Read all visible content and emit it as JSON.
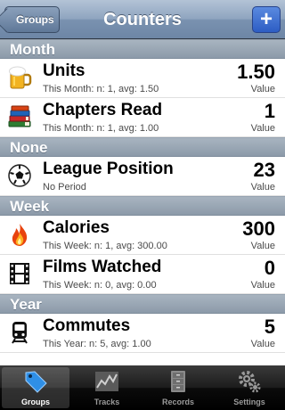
{
  "navbar": {
    "title": "Counters",
    "back_label": "Groups",
    "add_label": "+"
  },
  "sections": [
    {
      "header": "Month",
      "rows": [
        {
          "icon": "beer-mug-icon",
          "title": "Units",
          "subtitle": "This Month: n: 1, avg: 1.50",
          "value": "1.50",
          "value_label": "Value"
        },
        {
          "icon": "books-icon",
          "title": "Chapters Read",
          "subtitle": "This Month: n: 1, avg: 1.00",
          "value": "1",
          "value_label": "Value"
        }
      ]
    },
    {
      "header": "None",
      "rows": [
        {
          "icon": "soccer-ball-icon",
          "title": "League Position",
          "subtitle": "No Period",
          "value": "23",
          "value_label": "Value"
        }
      ]
    },
    {
      "header": "Week",
      "rows": [
        {
          "icon": "flame-icon",
          "title": "Calories",
          "subtitle": "This Week: n: 1, avg: 300.00",
          "value": "300",
          "value_label": "Value"
        },
        {
          "icon": "film-strip-icon",
          "title": "Films Watched",
          "subtitle": "This Week: n: 0, avg: 0.00",
          "value": "0",
          "value_label": "Value"
        }
      ]
    },
    {
      "header": "Year",
      "rows": [
        {
          "icon": "train-icon",
          "title": "Commutes",
          "subtitle": "This Year: n: 5, avg: 1.00",
          "value": "5",
          "value_label": "Value"
        }
      ]
    }
  ],
  "tabbar": {
    "tabs": [
      {
        "label": "Groups",
        "icon": "tag-icon",
        "selected": true
      },
      {
        "label": "Tracks",
        "icon": "chart-line-icon",
        "selected": false
      },
      {
        "label": "Records",
        "icon": "file-cabinet-icon",
        "selected": false
      },
      {
        "label": "Settings",
        "icon": "gears-icon",
        "selected": false
      }
    ]
  },
  "colors": {
    "navbar": "#7a92b0",
    "section_header": "#98a6b5",
    "add_button": "#3a6ad0",
    "tabbar": "#1c1c1c"
  }
}
